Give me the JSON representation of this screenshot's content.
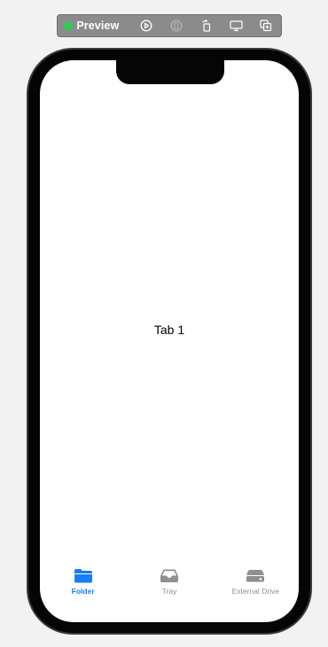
{
  "toolbar": {
    "title": "Preview",
    "status_color": "#35c759",
    "buttons": [
      {
        "icon": "play-circle-icon"
      },
      {
        "icon": "device-inspect-icon"
      },
      {
        "icon": "rotate-device-icon"
      },
      {
        "icon": "device-settings-icon"
      },
      {
        "icon": "duplicate-preview-icon"
      }
    ]
  },
  "screen": {
    "content_text": "Tab 1"
  },
  "tabbar": {
    "active_color": "#1a7cf5",
    "inactive_color": "#8e8e93",
    "tabs": [
      {
        "label": "Folder",
        "icon": "folder-icon",
        "active": true
      },
      {
        "label": "Tray",
        "icon": "tray-icon",
        "active": false
      },
      {
        "label": "External Drive",
        "icon": "external-drive-icon",
        "active": false
      }
    ]
  }
}
